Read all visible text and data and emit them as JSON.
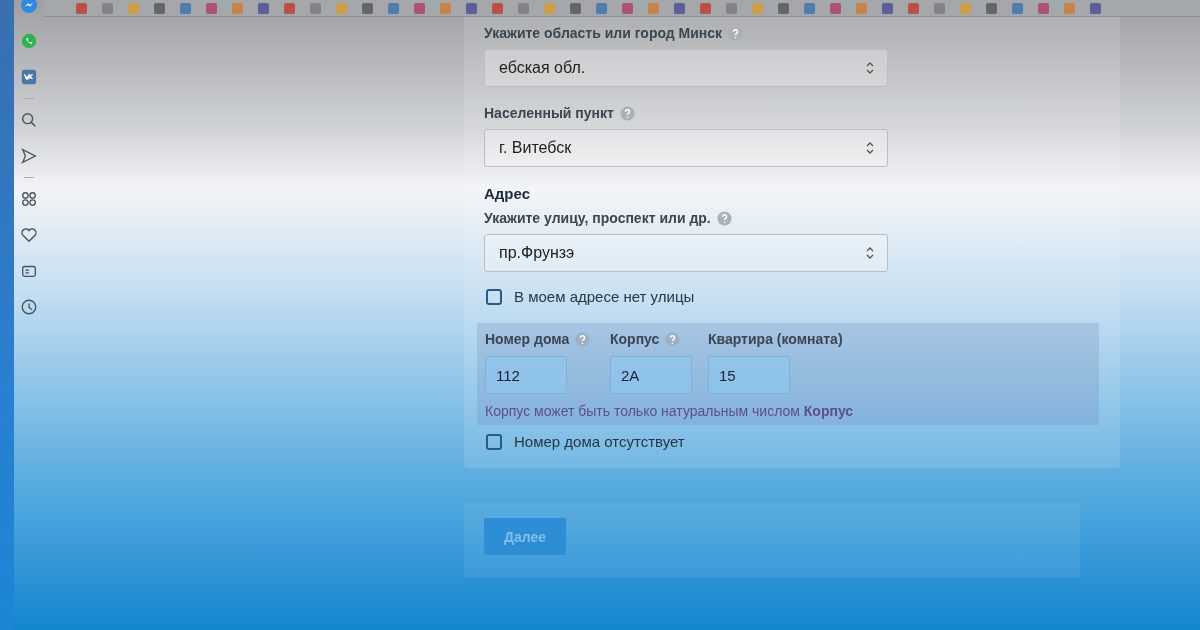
{
  "form": {
    "selects": [
      {
        "label": "Укажите область или город Минск",
        "help": true,
        "value": "ебская обл."
      },
      {
        "label": "Населенный пункт",
        "help": true,
        "value": "г. Витебск"
      }
    ],
    "address_heading": "Адрес",
    "street": {
      "label": "Укажите улицу, проспект или др.",
      "help": true,
      "value": "пр.Фрунзэ"
    },
    "no_street": {
      "label": "В моем адресе нет улицы",
      "checked": false
    },
    "house_fields": [
      {
        "label": "Номер дома",
        "help": true,
        "value": "112"
      },
      {
        "label": "Корпус",
        "help": true,
        "value": "2А"
      },
      {
        "label": "Квартира (комната)",
        "help": false,
        "value": "15"
      }
    ],
    "error": "Корпус может быть только натуральным числом **Корпус**",
    "no_house": {
      "label": "Номер дома отсутствует",
      "checked": false
    }
  },
  "next_button": {
    "label": "Далее",
    "disabled": true
  }
}
